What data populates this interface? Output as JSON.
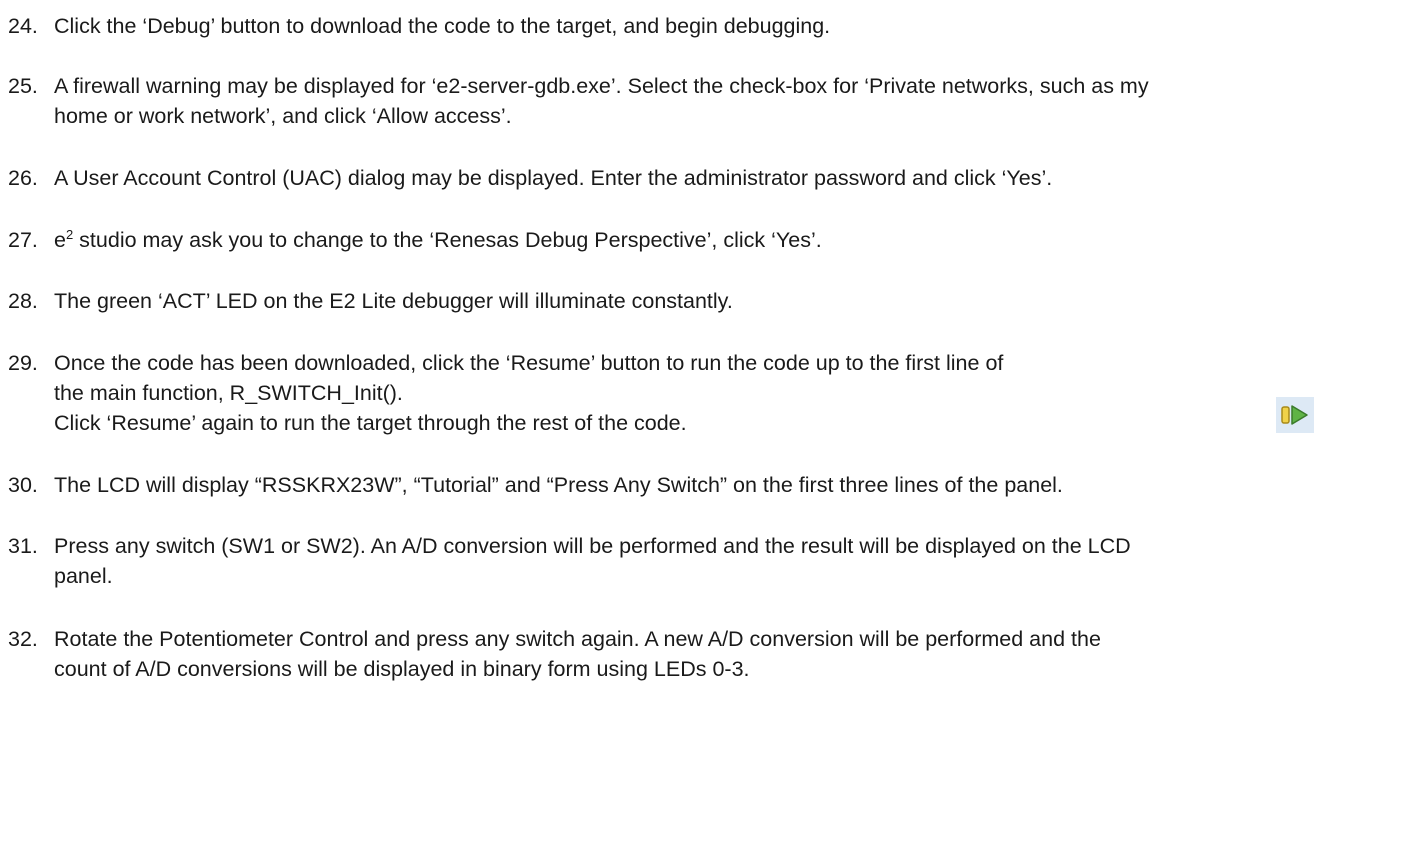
{
  "steps": [
    {
      "num": "24.",
      "lines": [
        "Click the ‘Debug’ button to download the code to the target, and begin debugging."
      ]
    },
    {
      "num": "25.",
      "lines": [
        "A firewall warning may be displayed for ‘e2-server-gdb.exe’. Select the check-box for ‘Private networks, such as my",
        "home or work network’, and click ‘Allow access’."
      ]
    },
    {
      "num": "26.",
      "lines": [
        "A User Account Control (UAC) dialog may be displayed. Enter the administrator password and click ‘Yes’."
      ]
    },
    {
      "num": "27.",
      "prefix": "e",
      "sup": "2",
      "lines": [
        " studio may ask you to change to the ‘Renesas Debug Perspective’, click ‘Yes’."
      ]
    },
    {
      "num": "28.",
      "lines": [
        "The green ‘ACT’ LED on the E2 Lite debugger will illuminate constantly."
      ]
    },
    {
      "num": "29.",
      "lines": [
        "Once the code has been downloaded, click the ‘Resume’ button to run the code up to the first line of",
        "the main function, R_SWITCH_Init().",
        "Click ‘Resume’ again to run the target through the rest of the code."
      ]
    },
    {
      "num": "30.",
      "lines": [
        "The LCD will display “RSSKRX23W”, “Tutorial” and “Press Any Switch” on the first three lines of the panel."
      ]
    },
    {
      "num": "31.",
      "lines": [
        "Press any switch (SW1 or SW2).  An A/D conversion will be performed and the result will be displayed on the LCD",
        "panel."
      ]
    },
    {
      "num": "32.",
      "lines": [
        "Rotate the Potentiometer Control and press any switch again.  A new A/D conversion will be performed and the",
        "count of A/D conversions will be displayed in binary form using LEDs 0-3."
      ]
    }
  ],
  "icons": {
    "resume": "resume-icon"
  },
  "colors": {
    "resume_green": "#5fb346",
    "resume_yellow": "#f0d24a",
    "icon_bg": "#dde9f5"
  }
}
